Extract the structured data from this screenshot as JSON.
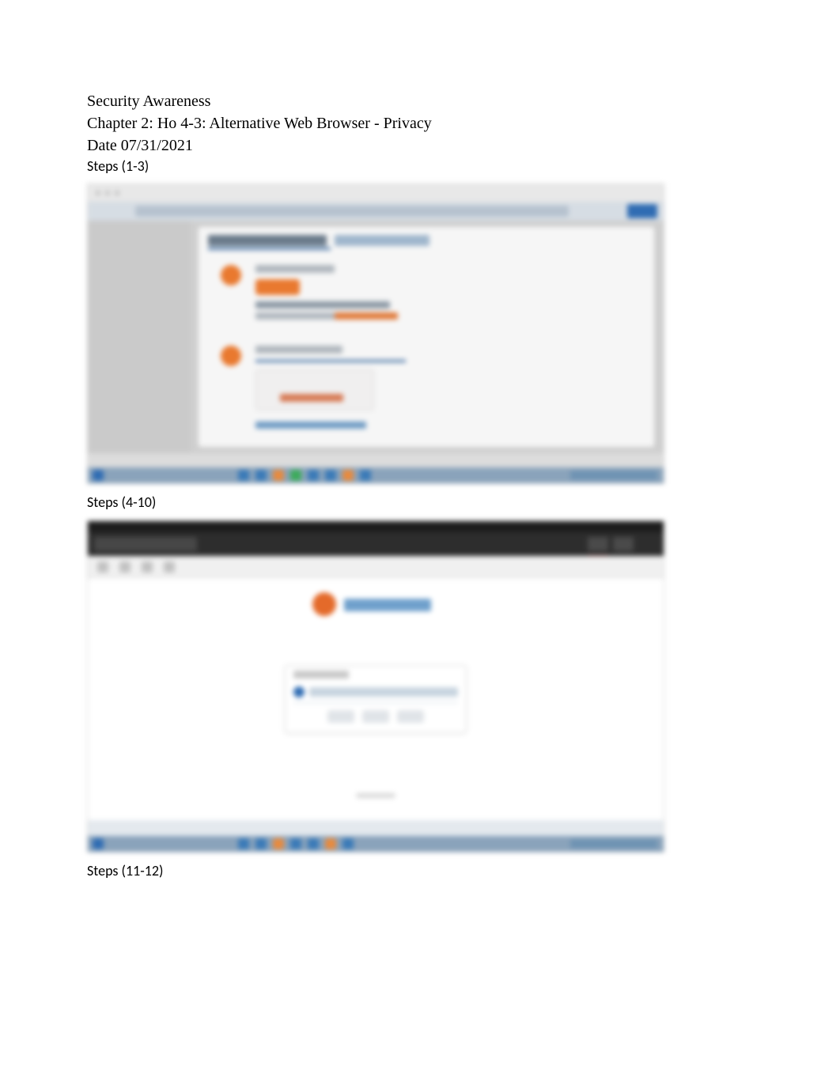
{
  "header": {
    "line1": "Security Awareness",
    "line2": "Chapter 2: Ho 4-3: Alternative Web Browser - Privacy",
    "line3": "Date 07/31/2021"
  },
  "sections": {
    "steps1_label": "Steps (1-3)",
    "steps2_label": "Steps (4-10)",
    "steps3_label": "Steps (11-12)"
  }
}
